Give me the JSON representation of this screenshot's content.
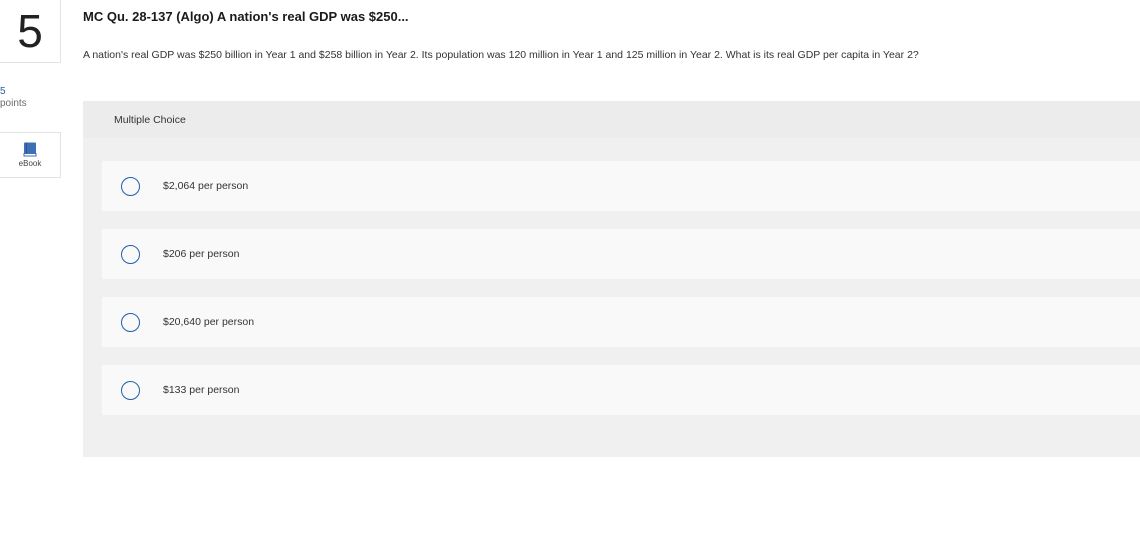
{
  "question": {
    "number": "5",
    "points_value": "5",
    "points_label": "points",
    "ebook_label": "eBook",
    "title": "MC Qu. 28-137 (Algo) A nation's real GDP was $250...",
    "text": "A nation's real GDP was $250 billion in Year 1 and $258 billion in Year 2. Its population was 120 million in Year 1 and 125 million in Year 2. What is its real GDP per capita in Year 2?"
  },
  "multiple_choice": {
    "header": "Multiple Choice",
    "options": [
      {
        "label": "$2,064 per person"
      },
      {
        "label": "$206 per person"
      },
      {
        "label": "$20,640 per person"
      },
      {
        "label": "$133 per person"
      }
    ]
  },
  "colors": {
    "accent": "#1f5fad",
    "points_value": "#2a5fa8",
    "book_icon": "#3d6fb5"
  },
  "icons": {
    "ebook": "book-icon",
    "option": "radio-button"
  }
}
